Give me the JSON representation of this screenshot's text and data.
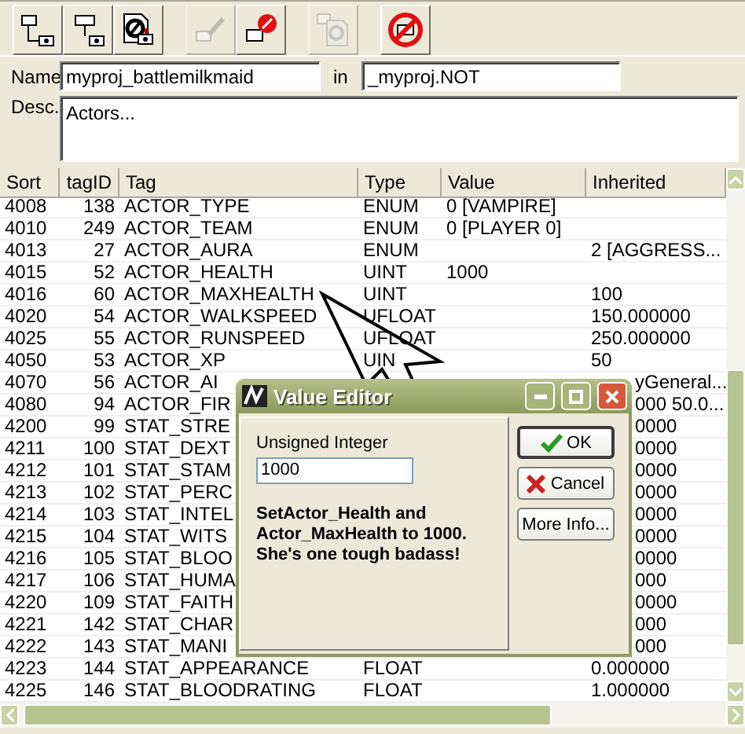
{
  "toolbar": [
    {
      "kind": "tree-child",
      "disabled": false
    },
    {
      "kind": "tree-sibling",
      "disabled": false
    },
    {
      "kind": "file-link",
      "disabled": false
    },
    {
      "kind": "edit",
      "disabled": true
    },
    {
      "kind": "remove",
      "disabled": false
    },
    {
      "kind": "copy",
      "disabled": true
    },
    {
      "kind": "forbid",
      "disabled": false
    }
  ],
  "name_field": {
    "label": "Name",
    "value": "myproj_battlemilkmaid"
  },
  "in_field": {
    "label": "in",
    "value": "_myproj.NOT"
  },
  "desc_field": {
    "label": "Desc.",
    "value": "Actors..."
  },
  "table": {
    "columns": [
      "Sort",
      "tagID",
      "Tag",
      "Type",
      "Value",
      "Inherited"
    ],
    "rows": [
      {
        "sort": "4008",
        "tag_id": "138",
        "tag": "ACTOR_TYPE",
        "type": "ENUM",
        "value": "0  [VAMPIRE]"
      },
      {
        "sort": "4010",
        "tag_id": "249",
        "tag": "ACTOR_TEAM",
        "type": "ENUM",
        "value": "0  [PLAYER 0]"
      },
      {
        "sort": "4013",
        "tag_id": "27",
        "tag": "ACTOR_AURA",
        "type": "ENUM",
        "inherited": "2  [AGGRESS..."
      },
      {
        "sort": "4015",
        "tag_id": "52",
        "tag": "ACTOR_HEALTH",
        "type": "UINT",
        "value": "1000"
      },
      {
        "sort": "4016",
        "tag_id": "60",
        "tag": "ACTOR_MAXHEALTH",
        "type": "UINT",
        "inherited": "100"
      },
      {
        "sort": "4020",
        "tag_id": "54",
        "tag": "ACTOR_WALKSPEED",
        "type": "UFLOAT",
        "inherited": "150.000000"
      },
      {
        "sort": "4025",
        "tag_id": "55",
        "tag": "ACTOR_RUNSPEED",
        "type": "UFLOAT",
        "inherited": "250.000000"
      },
      {
        "sort": "4050",
        "tag_id": "53",
        "tag": "ACTOR_XP",
        "type": "UIN",
        "inherited": "50"
      },
      {
        "sort": "4070",
        "tag_id": "56",
        "tag": "ACTOR_AI",
        "inherited": "yGeneral..."
      },
      {
        "sort": "4080",
        "tag_id": "94",
        "tag": "ACTOR_FIR",
        "inherited": "000 50.0..."
      },
      {
        "sort": "4200",
        "tag_id": "99",
        "tag": "STAT_STRE",
        "inherited": "0000"
      },
      {
        "sort": "4211",
        "tag_id": "100",
        "tag": "STAT_DEXT",
        "inherited": "0000"
      },
      {
        "sort": "4212",
        "tag_id": "101",
        "tag": "STAT_STAM",
        "inherited": "0000"
      },
      {
        "sort": "4213",
        "tag_id": "102",
        "tag": "STAT_PERC",
        "inherited": "0000"
      },
      {
        "sort": "4214",
        "tag_id": "103",
        "tag": "STAT_INTEL",
        "inherited": "0000"
      },
      {
        "sort": "4215",
        "tag_id": "104",
        "tag": "STAT_WITS",
        "inherited": "0000"
      },
      {
        "sort": "4216",
        "tag_id": "105",
        "tag": "STAT_BLOO",
        "inherited": "0000"
      },
      {
        "sort": "4217",
        "tag_id": "106",
        "tag": "STAT_HUMA",
        "inherited": "000"
      },
      {
        "sort": "4220",
        "tag_id": "109",
        "tag": "STAT_FAITH",
        "inherited": "0000"
      },
      {
        "sort": "4221",
        "tag_id": "142",
        "tag": "STAT_CHAR",
        "inherited": "000"
      },
      {
        "sort": "4222",
        "tag_id": "143",
        "tag": "STAT_MANI",
        "inherited": "000"
      },
      {
        "sort": "4223",
        "tag_id": "144",
        "tag": "STAT_APPEARANCE",
        "type": "FLOAT",
        "inherited": "0.000000"
      },
      {
        "sort": "4225",
        "tag_id": "146",
        "tag": "STAT_BLOODRATING",
        "type": "FLOAT",
        "inherited": "1.000000"
      }
    ]
  },
  "dialog": {
    "title": "Value Editor",
    "field_label": "Unsigned Integer",
    "value": "1000",
    "message": "SetActor_Health and Actor_MaxHealth to 1000. She's one tough badass!",
    "buttons": [
      {
        "label": "OK",
        "kind": "ok",
        "default": true
      },
      {
        "label": "Cancel",
        "kind": "cancel",
        "default": false
      },
      {
        "label": "More Info...",
        "kind": "info",
        "default": false
      }
    ]
  }
}
